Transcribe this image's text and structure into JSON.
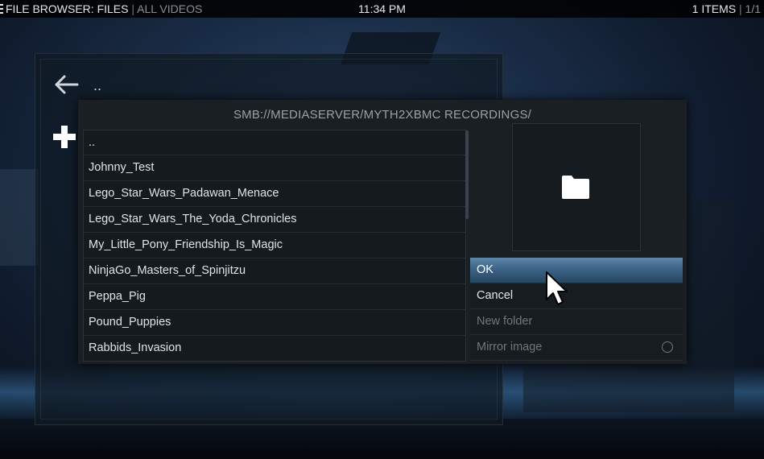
{
  "topbar": {
    "title": "FILE BROWSER: FILES",
    "separator": "|",
    "subtitle": "ALL VIDEOS",
    "clock": "11:34 PM",
    "items_count": "1 ITEMS",
    "page_indicator": "1/1"
  },
  "browser": {
    "back_label": ".."
  },
  "dialog": {
    "path": "SMB://MEDIASERVER/MYTH2XBMC RECORDINGS/",
    "items": [
      "..",
      "Johnny_Test",
      "Lego_Star_Wars_Padawan_Menace",
      "Lego_Star_Wars_The_Yoda_Chronicles",
      "My_Little_Pony_Friendship_Is_Magic",
      "NinjaGo_Masters_of_Spinjitzu",
      "Peppa_Pig",
      "Pound_Puppies",
      "Rabbids_Invasion"
    ],
    "buttons": {
      "ok": "OK",
      "cancel": "Cancel",
      "new_folder": "New folder",
      "mirror_image": "Mirror image"
    }
  },
  "icons": {
    "menu": "menu-icon",
    "back": "back-arrow-icon",
    "add": "plus-icon",
    "folder": "folder-icon",
    "radio": "radio-off-icon",
    "cursor": "mouse-cursor-icon"
  },
  "colors": {
    "focus_accent": "#3c6488",
    "dialog_bg": "#1a1f24",
    "disabled_text": "#6f777e"
  }
}
